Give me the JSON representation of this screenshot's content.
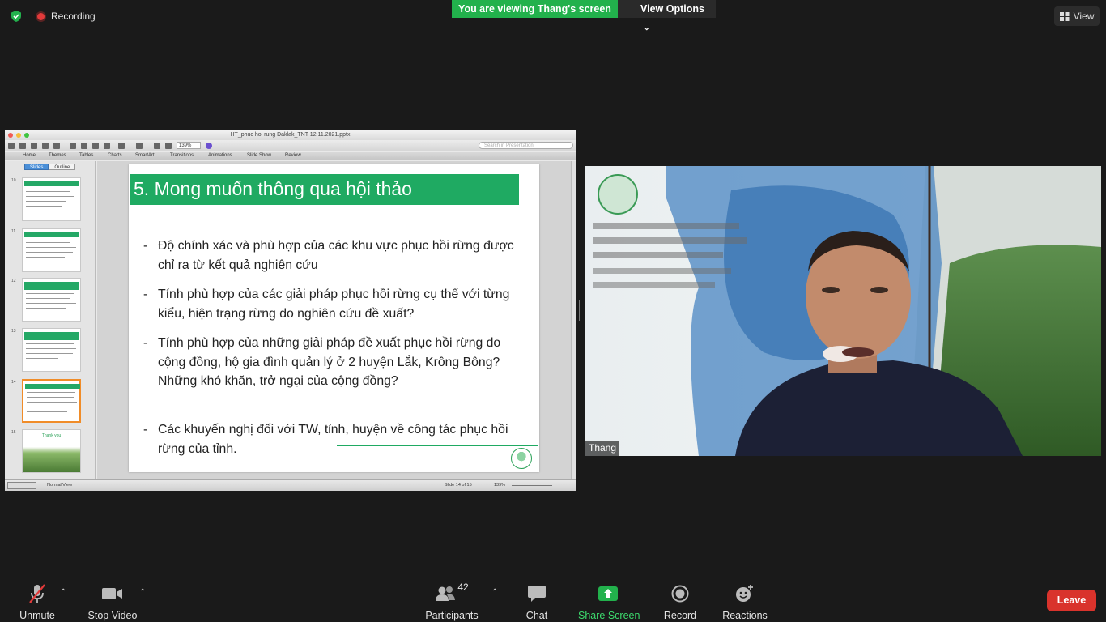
{
  "top": {
    "recording_label": "Recording",
    "viewing_banner": "You are viewing Thang's screen",
    "view_options": "View Options",
    "view_button": "View"
  },
  "ppt": {
    "window_title": "HT_phuc hoi rung Daklak_TNT 12.11.2021.pptx",
    "zoom": "139%",
    "search_placeholder": "Search in Presentation",
    "ribbon_tabs": [
      "Home",
      "Themes",
      "Tables",
      "Charts",
      "SmartArt",
      "Transitions",
      "Animations",
      "Slide Show",
      "Review"
    ],
    "panel_tabs": [
      "Slides",
      "Outline"
    ],
    "thumbnails": [
      "10",
      "11",
      "12",
      "13",
      "14",
      "15"
    ],
    "thank_you": "Thank you",
    "status_view": "Normal View",
    "status_slide": "Slide 14 of 15",
    "status_zoom": "139%"
  },
  "slide": {
    "title": "5. Mong muốn thông qua hội thảo",
    "bullets": [
      "Độ chính xác và phù hợp của các khu vực phục hồi rừng được chỉ ra từ kết quả nghiên cứu",
      "Tính phù hợp của các giải pháp phục hồi rừng cụ thể với từng kiểu, hiện trạng rừng do nghiên cứu đề xuất?",
      "Tính phù hợp của những giải pháp đề xuất phục hồi rừng do cộng đồng, hộ gia đình quản lý ở 2 huyện Lắk, Krông Bông? Những khó khăn, trở ngại của cộng đồng?",
      "Các khuyến nghị đối với TW, tỉnh, huyện về công tác phục hồi rừng của tỉnh."
    ],
    "bullet_dash": "-"
  },
  "video": {
    "name": "Thang"
  },
  "controls": {
    "unmute": "Unmute",
    "stop_video": "Stop Video",
    "participants": "Participants",
    "participants_count": "42",
    "chat": "Chat",
    "share_screen": "Share Screen",
    "record": "Record",
    "reactions": "Reactions",
    "leave": "Leave"
  },
  "colors": {
    "zoom_green": "#22b14c",
    "slide_green": "#1faa62",
    "leave_red": "#d9332c"
  }
}
